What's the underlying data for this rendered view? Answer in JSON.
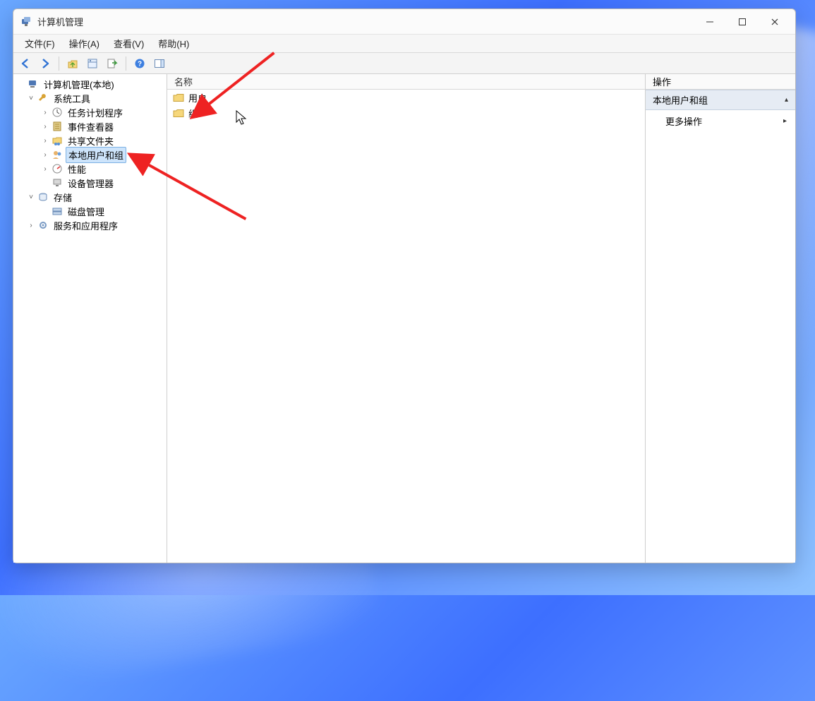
{
  "window": {
    "title": "计算机管理"
  },
  "menubar": {
    "items": [
      "文件(F)",
      "操作(A)",
      "查看(V)",
      "帮助(H)"
    ]
  },
  "toolbar": {
    "back": "back-arrow-icon",
    "forward": "forward-arrow-icon",
    "up": "up-folder-icon",
    "properties": "properties-grid-icon",
    "export": "export-list-icon",
    "help": "help-icon",
    "show_action": "show-action-pane-icon"
  },
  "tree": {
    "root": {
      "label": "计算机管理(本地)"
    },
    "system_tools": {
      "label": "系统工具"
    },
    "task_scheduler": {
      "label": "任务计划程序"
    },
    "event_viewer": {
      "label": "事件查看器"
    },
    "shared_folders": {
      "label": "共享文件夹"
    },
    "local_users_groups": {
      "label": "本地用户和组"
    },
    "performance": {
      "label": "性能"
    },
    "device_manager": {
      "label": "设备管理器"
    },
    "storage": {
      "label": "存储"
    },
    "disk_management": {
      "label": "磁盘管理"
    },
    "services_apps": {
      "label": "服务和应用程序"
    }
  },
  "list": {
    "header": "名称",
    "rows": [
      {
        "label": "用户"
      },
      {
        "label": "组"
      }
    ]
  },
  "actions": {
    "header": "操作",
    "section_title": "本地用户和组",
    "more_actions": "更多操作"
  }
}
